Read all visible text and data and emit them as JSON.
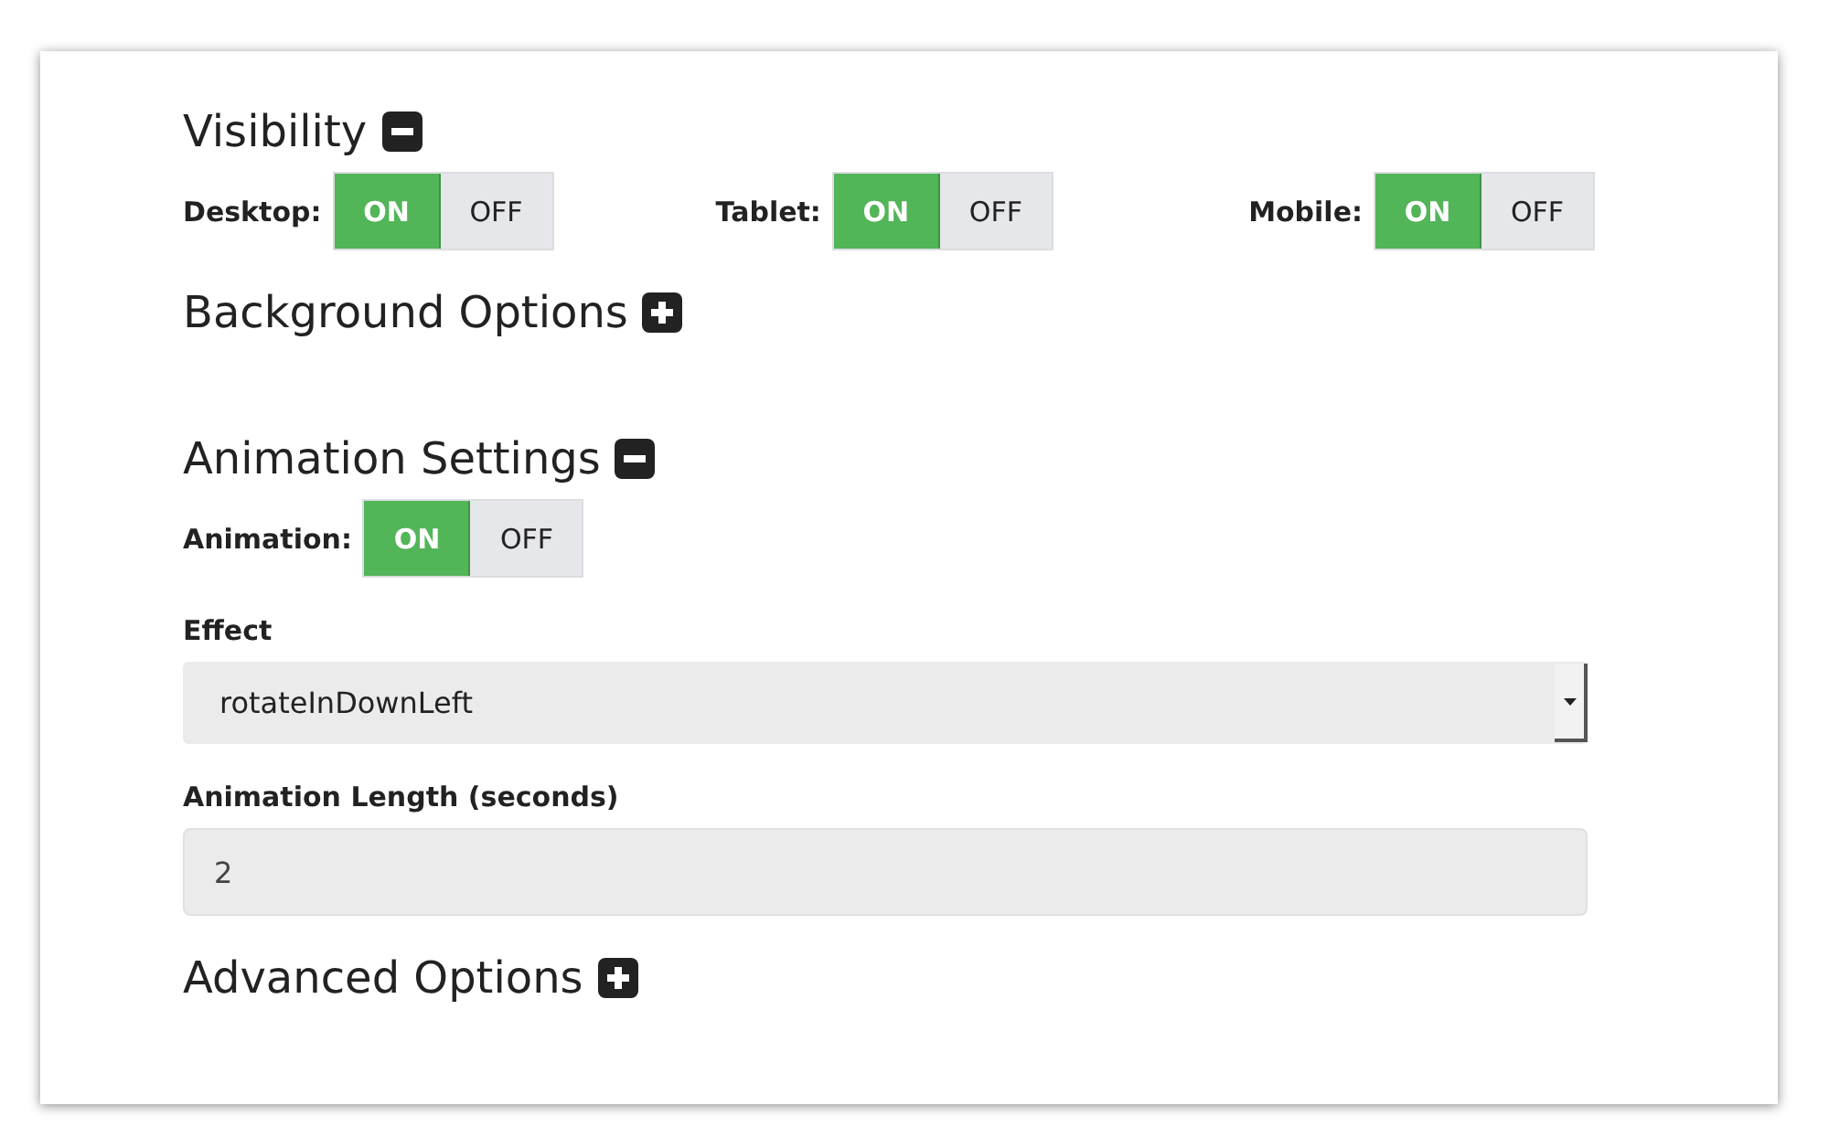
{
  "sections": [
    {
      "title": "Visibility",
      "expanded": true,
      "toggles": [
        {
          "label": "Desktop:",
          "options": [
            {
              "label": "ON",
              "selected": true
            },
            {
              "label": "OFF",
              "selected": false
            }
          ]
        },
        {
          "label": "Tablet:",
          "options": [
            {
              "label": "ON",
              "selected": true
            },
            {
              "label": "OFF",
              "selected": false
            }
          ]
        },
        {
          "label": "Mobile:",
          "options": [
            {
              "label": "ON",
              "selected": true
            },
            {
              "label": "OFF",
              "selected": false
            }
          ]
        }
      ]
    },
    {
      "title": "Background Options",
      "expanded": false
    },
    {
      "title": "Animation Settings",
      "expanded": true,
      "toggles": [
        {
          "label": "Animation:",
          "options": [
            {
              "label": "ON",
              "selected": true
            },
            {
              "label": "OFF",
              "selected": false
            }
          ]
        }
      ],
      "fields": [
        {
          "kind": "select",
          "label": "Effect",
          "value": "rotateInDownLeft"
        },
        {
          "kind": "text",
          "label": "Animation Length (seconds)",
          "value": "2"
        }
      ]
    },
    {
      "title": "Advanced Options",
      "expanded": false
    }
  ]
}
